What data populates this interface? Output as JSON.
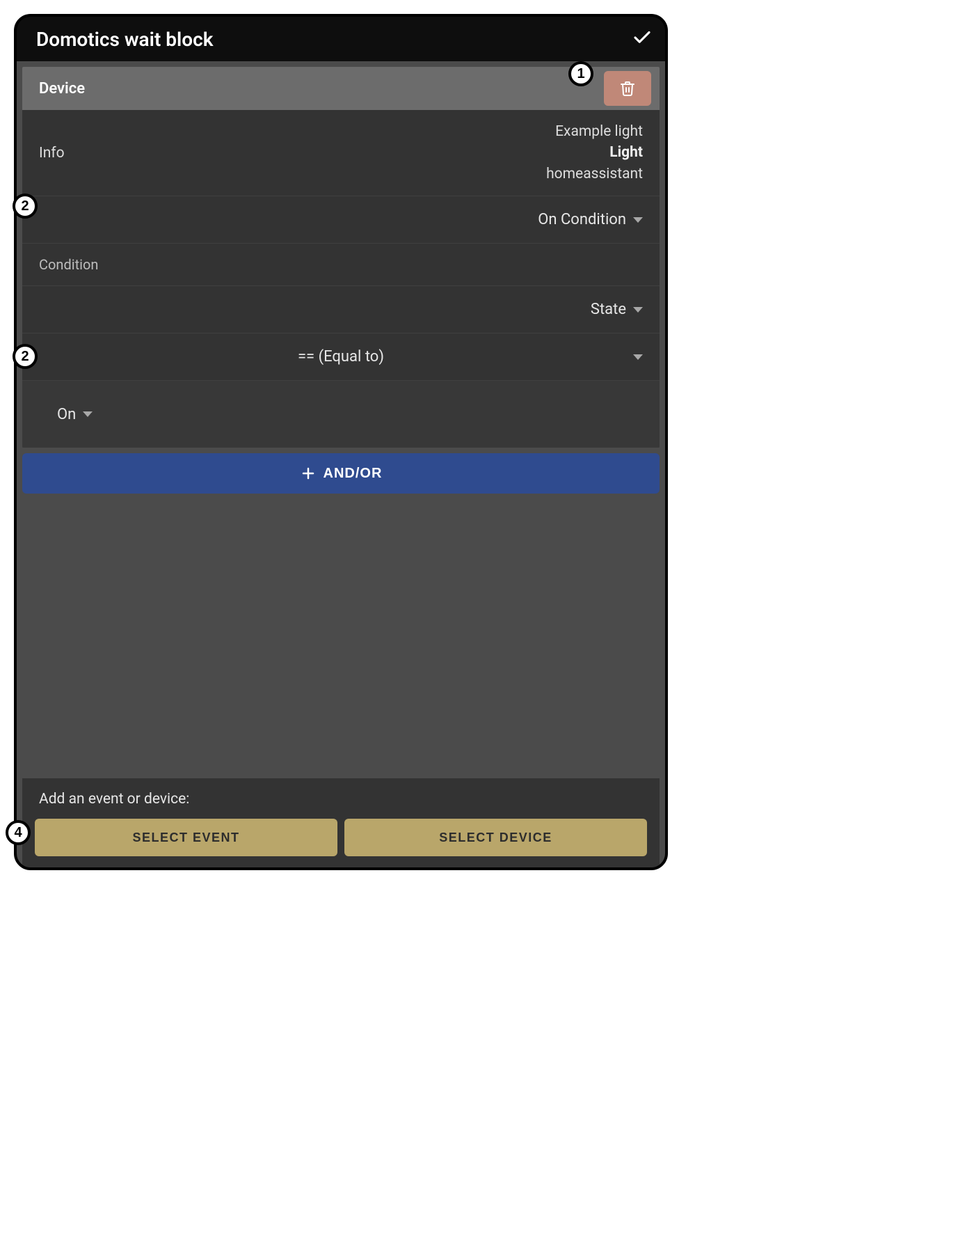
{
  "header": {
    "title": "Domotics wait block"
  },
  "device": {
    "header_label": "Device",
    "info_label": "Info",
    "info_name": "Example light",
    "info_type": "Light",
    "info_source": "homeassistant",
    "trigger_label": "On Condition",
    "condition_section_label": "Condition",
    "condition_attr": "State",
    "operator": "== (Equal to)",
    "value": "On"
  },
  "andor": {
    "label": "AND/OR"
  },
  "footer": {
    "prompt": "Add an event or device:",
    "select_event": "SELECT EVENT",
    "select_device": "SELECT DEVICE"
  },
  "annotations": {
    "b1": "1",
    "b2a": "2",
    "b2b": "2",
    "b4": "4"
  }
}
